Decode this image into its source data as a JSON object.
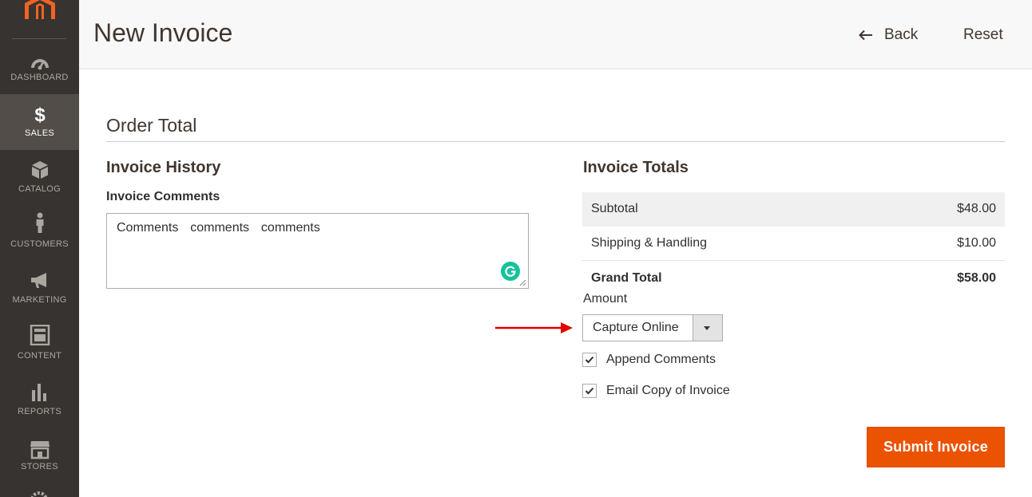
{
  "sidebar": {
    "items": [
      {
        "label": "DASHBOARD",
        "icon": "dashboard-icon",
        "active": false
      },
      {
        "label": "SALES",
        "icon": "dollar-icon",
        "active": true
      },
      {
        "label": "CATALOG",
        "icon": "box-icon",
        "active": false
      },
      {
        "label": "CUSTOMERS",
        "icon": "person-icon",
        "active": false
      },
      {
        "label": "MARKETING",
        "icon": "megaphone-icon",
        "active": false
      },
      {
        "label": "CONTENT",
        "icon": "layout-icon",
        "active": false
      },
      {
        "label": "REPORTS",
        "icon": "bar-chart-icon",
        "active": false
      },
      {
        "label": "STORES",
        "icon": "store-icon",
        "active": false
      }
    ]
  },
  "header": {
    "title": "New Invoice",
    "back_label": "Back",
    "reset_label": "Reset"
  },
  "main": {
    "section_title": "Order Total",
    "history": {
      "title": "Invoice History",
      "comments_label": "Invoice Comments",
      "comments_value": "Comments  comments  comments"
    },
    "totals": {
      "title": "Invoice Totals",
      "rows": [
        {
          "label": "Subtotal",
          "value": "$48.00"
        },
        {
          "label": "Shipping & Handling",
          "value": "$10.00"
        },
        {
          "label": "Grand Total",
          "value": "$58.00"
        }
      ],
      "amount_label": "Amount",
      "amount_selected": "Capture Online",
      "append_comments_label": "Append Comments",
      "append_comments_checked": true,
      "email_copy_label": "Email Copy of Invoice",
      "email_copy_checked": true,
      "submit_label": "Submit Invoice"
    }
  },
  "colors": {
    "sidebar_bg": "#373330",
    "sidebar_active": "#524d49",
    "accent": "#eb5202",
    "annotation_arrow": "#e00000"
  }
}
